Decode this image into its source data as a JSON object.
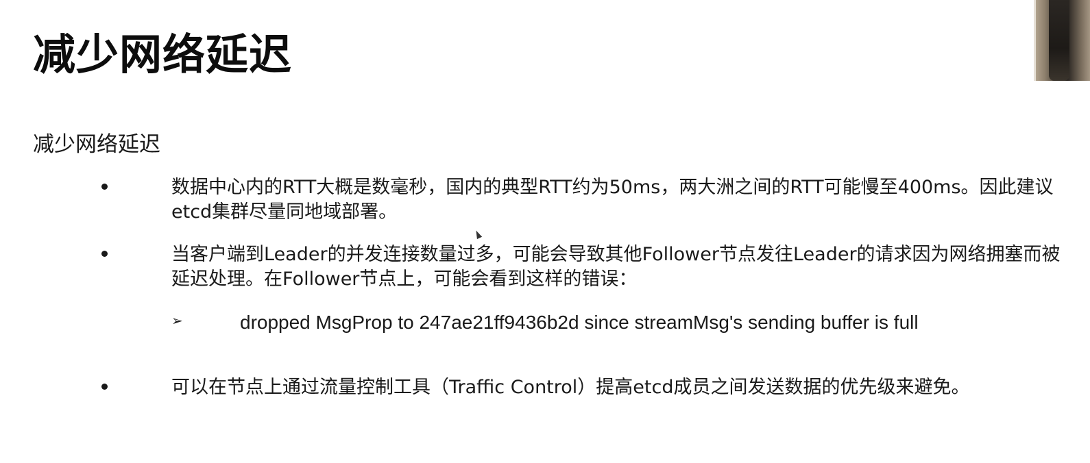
{
  "slide": {
    "title": "减少网络延迟",
    "subtitle": "减少网络延迟",
    "bullets": [
      {
        "text": "数据中心内的RTT大概是数毫秒，国内的典型RTT约为50ms，两大洲之间的RTT可能慢至400ms。因此建议etcd集群尽量同地域部署。"
      },
      {
        "text": "当客户端到Leader的并发连接数量过多，可能会导致其他Follower节点发往Leader的请求因为网络拥塞而被延迟处理。在Follower节点上，可能会看到这样的错误："
      },
      {
        "text": "可以在节点上通过流量控制工具（Traffic Control）提高etcd成员之间发送数据的优先级来避免。"
      }
    ],
    "sub_bullet": {
      "marker": "➢",
      "text": "dropped MsgProp to 247ae21ff9436b2d since streamMsg's sending buffer is full"
    }
  }
}
